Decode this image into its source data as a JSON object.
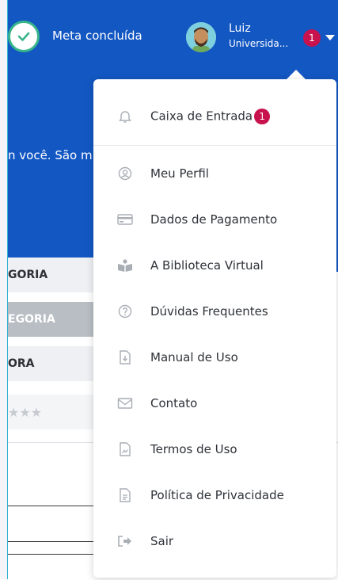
{
  "header": {
    "goal_label": "Meta concluída",
    "user_name": "Luiz",
    "user_org": "Universida...",
    "notification_count": "1"
  },
  "intro_text": "n você. São mi",
  "categories": {
    "row1": "GORIA",
    "row2": "EGORIA",
    "row3": "ORA",
    "stars": "★★★"
  },
  "menu": {
    "items": [
      {
        "label": "Caixa de Entrada",
        "badge": "1",
        "icon": "bell-icon"
      },
      {
        "label": "Meu Perfil",
        "icon": "user-circle-icon"
      },
      {
        "label": "Dados de Pagamento",
        "icon": "credit-card-icon"
      },
      {
        "label": "A Biblioteca Virtual",
        "icon": "reader-icon"
      },
      {
        "label": "Dúvidas Frequentes",
        "icon": "question-icon"
      },
      {
        "label": "Manual de Uso",
        "icon": "download-doc-icon"
      },
      {
        "label": "Contato",
        "icon": "envelope-icon"
      },
      {
        "label": "Termos de Uso",
        "icon": "document-image-icon"
      },
      {
        "label": "Política de Privacidade",
        "icon": "document-text-icon"
      },
      {
        "label": "Sair",
        "icon": "sign-out-icon"
      }
    ]
  },
  "colors": {
    "brand_blue": "#1357c2",
    "badge_red": "#c8124e",
    "success_green": "#38b58a"
  }
}
